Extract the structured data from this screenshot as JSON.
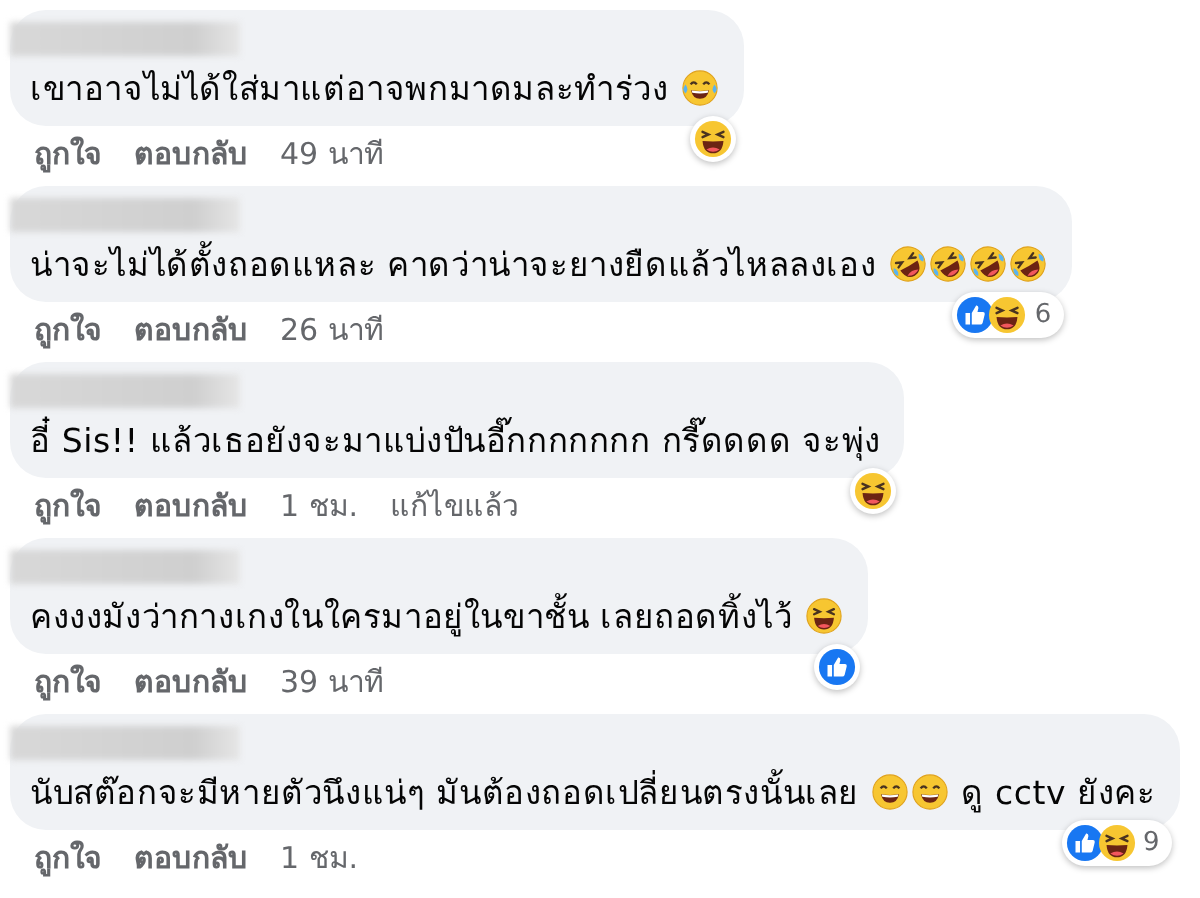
{
  "comments": [
    {
      "parts": [
        {
          "kind": "text",
          "text": "เขาอาจไม่ได้ใส่มาแต่อาจพกมาดมละทำร่วง"
        },
        {
          "kind": "tears"
        }
      ],
      "reactions": [
        {
          "kind": "haha"
        }
      ],
      "actions": [
        "ถูกใจ",
        "ตอบกลับ"
      ],
      "time": "49 นาที"
    },
    {
      "parts": [
        {
          "kind": "text",
          "text": "น่าจะไม่ได้ตั้งถอดแหละ คาดว่าน่าจะยางยืดแล้วไหลลงเอง"
        },
        {
          "kind": "rofl"
        },
        {
          "kind": "rofl"
        },
        {
          "kind": "rofl"
        },
        {
          "kind": "rofl"
        }
      ],
      "reactions": [
        {
          "kind": "like"
        },
        {
          "kind": "haha"
        }
      ],
      "reaction_count": "6",
      "actions": [
        "ถูกใจ",
        "ตอบกลับ"
      ],
      "time": "26 นาที"
    },
    {
      "parts": [
        {
          "kind": "text",
          "text": "อี๋ Sis!! แล้วเธอยังจะมาแบ่งปันอี๊กกกกกกก กรี๊ดดดด จะพุ่ง"
        }
      ],
      "reactions": [
        {
          "kind": "haha"
        }
      ],
      "actions": [
        "ถูกใจ",
        "ตอบกลับ"
      ],
      "time": "1 ชม.",
      "edited": "แก้ไขแล้ว"
    },
    {
      "parts": [
        {
          "kind": "text",
          "text": "คงงงมังว่ากางเกงในใครมาอยู่ในขาชั้น เลยถอดทิ้งไว้"
        },
        {
          "kind": "squint"
        }
      ],
      "reactions": [
        {
          "kind": "like"
        }
      ],
      "actions": [
        "ถูกใจ",
        "ตอบกลับ"
      ],
      "time": "39 นาที"
    },
    {
      "parts": [
        {
          "kind": "text",
          "text": "นับสต๊อกจะมีหายตัวนึงแน่ๆ มันต้องถอดเปลี่ยนตรงนั้นเลย"
        },
        {
          "kind": "grin"
        },
        {
          "kind": "grin"
        },
        {
          "kind": "text",
          "text": "ดู cctv ยังคะ"
        }
      ],
      "reactions": [
        {
          "kind": "like"
        },
        {
          "kind": "haha"
        }
      ],
      "reaction_count": "9",
      "actions": [
        "ถูกใจ",
        "ตอบกลับ"
      ],
      "time": "1 ชม."
    }
  ]
}
